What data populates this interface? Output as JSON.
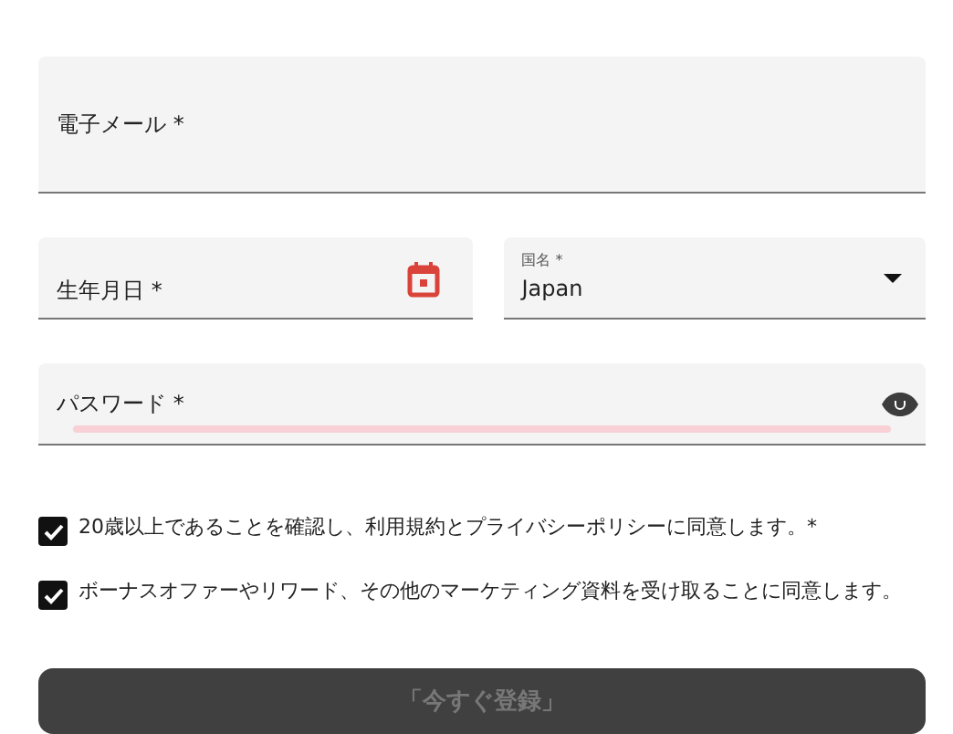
{
  "fields": [
    {
      "kind": "text",
      "label": "電子メール *"
    },
    {
      "kind": "date",
      "label": "生年月日 *"
    },
    {
      "kind": "select",
      "label": "国名 *",
      "value": "Japan"
    },
    {
      "kind": "password",
      "label": "パスワード *"
    }
  ],
  "checkboxes": [
    {
      "label": "20歳以上であることを確認し、利用規約とプライバシーポリシーに同意します。*",
      "checked": true
    },
    {
      "label": "ボーナスオファーやリワード、その他のマーケティング資料を受け取ることに同意します。",
      "checked": true
    }
  ],
  "submit": {
    "label": "「今すぐ登録」",
    "disabled": true
  }
}
